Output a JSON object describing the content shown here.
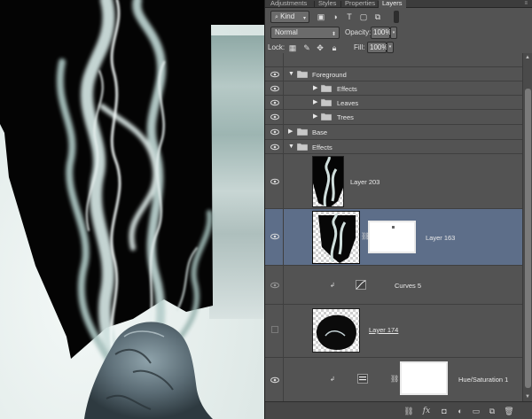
{
  "panel": {
    "tabs": [
      {
        "label": "Adjustments",
        "active": false
      },
      {
        "label": "Styles",
        "active": false
      },
      {
        "label": "Properties",
        "active": false
      },
      {
        "label": "Layers",
        "active": true
      }
    ],
    "filter": {
      "kind_label": "Kind"
    },
    "blend": {
      "mode": "Normal",
      "opacity_label": "Opacity:",
      "opacity_value": "100%"
    },
    "lock": {
      "lock_label": "Lock:",
      "fill_label": "Fill:",
      "fill_value": "100%"
    }
  },
  "layers": [
    {
      "name": "Foreground",
      "type": "group",
      "expanded": true,
      "indent": 0
    },
    {
      "name": "Effects",
      "type": "group",
      "expanded": false,
      "indent": 1
    },
    {
      "name": "Leaves",
      "type": "group",
      "expanded": false,
      "indent": 1
    },
    {
      "name": "Trees",
      "type": "group",
      "expanded": false,
      "indent": 1
    },
    {
      "name": "Base",
      "type": "group",
      "expanded": false,
      "indent": 0
    },
    {
      "name": "Effects",
      "type": "group",
      "expanded": true,
      "indent": 0
    },
    {
      "name": "Layer 203",
      "type": "pixel",
      "visible": true
    },
    {
      "name": "Layer 163",
      "type": "pixel-mask",
      "visible": true,
      "selected": true
    },
    {
      "name": "Curves 5",
      "type": "adjustment",
      "visible": true,
      "clipped": true
    },
    {
      "name": "Layer 174",
      "type": "pixel",
      "visible": false
    },
    {
      "name": "Hue/Saturation 1",
      "type": "adjustment-mask",
      "visible": true,
      "clipped": true
    }
  ],
  "colors": {
    "panel_bg": "#535353",
    "selected_row": "#5d6e89"
  }
}
